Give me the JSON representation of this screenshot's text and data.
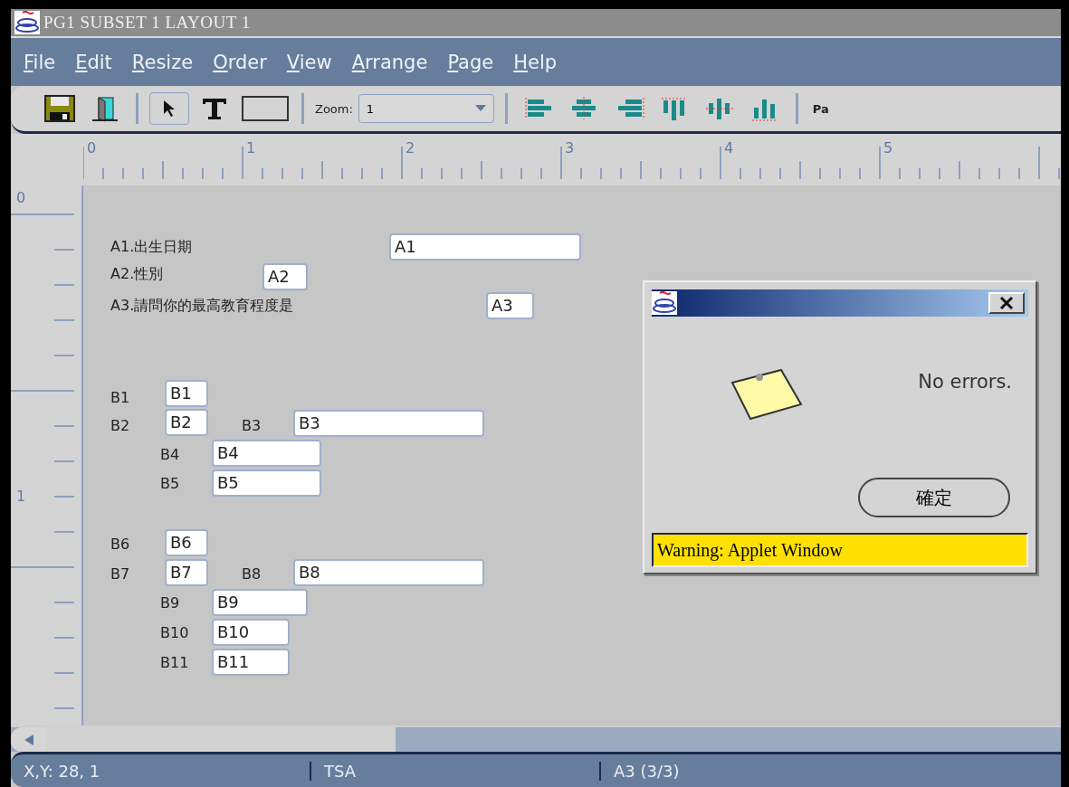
{
  "window": {
    "title": "PG1 SUBSET 1 LAYOUT 1"
  },
  "menu": [
    "File",
    "Edit",
    "Resize",
    "Order",
    "View",
    "Arrange",
    "Page",
    "Help"
  ],
  "toolbar": {
    "zoom_label": "Zoom:",
    "zoom_value": "1",
    "cut_label": "Pa"
  },
  "ruler": {
    "horizontal": [
      "0",
      "1",
      "2",
      "3",
      "4",
      "5"
    ],
    "vertical": [
      "0",
      "1"
    ]
  },
  "canvas": {
    "items": [
      {
        "label": "A1.出生日期",
        "field": "A1"
      },
      {
        "label": "A2.性別",
        "field": "A2"
      },
      {
        "label": "A3.請問你的最高教育程度是",
        "field": "A3"
      },
      {
        "label": "B1",
        "field": "B1"
      },
      {
        "label": "B2",
        "field": "B2"
      },
      {
        "label": "B3",
        "field": "B3"
      },
      {
        "label": "B4",
        "field": "B4"
      },
      {
        "label": "B5",
        "field": "B5"
      },
      {
        "label": "B6",
        "field": "B6"
      },
      {
        "label": "B7",
        "field": "B7"
      },
      {
        "label": "B8",
        "field": "B8"
      },
      {
        "label": "B9",
        "field": "B9"
      },
      {
        "label": "B10",
        "field": "B10"
      },
      {
        "label": "B11",
        "field": "B11"
      }
    ]
  },
  "dialog": {
    "message": "No errors.",
    "button": "確定",
    "warning": "Warning: Applet Window"
  },
  "status_bar": [
    "X,Y: 28, 1",
    "TSA",
    "A3 (3/3)"
  ]
}
